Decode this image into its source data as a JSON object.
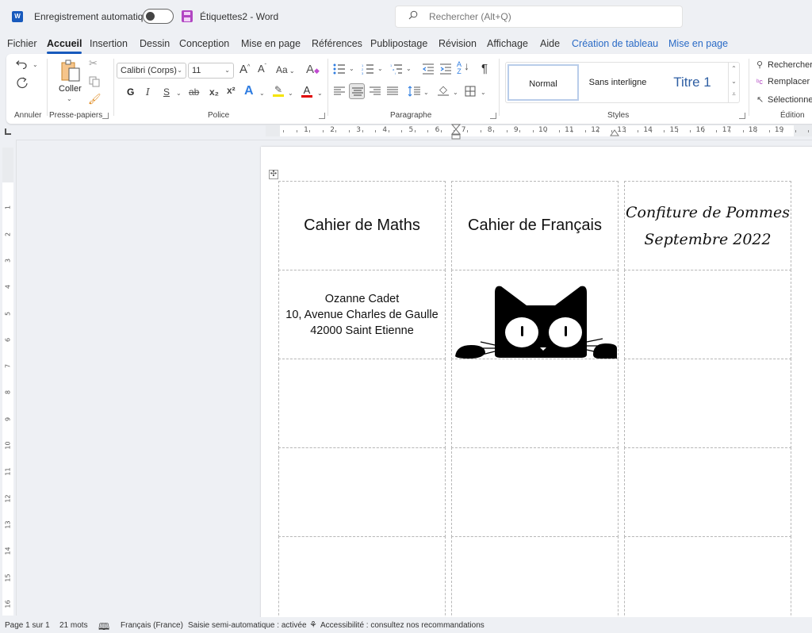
{
  "titlebar": {
    "app_icon": "word-icon",
    "autosave_label": "Enregistrement automatique",
    "autosave_on": false,
    "save_icon": "save-icon",
    "doc_title": "Étiquettes2  -  Word"
  },
  "search": {
    "placeholder": "Rechercher (Alt+Q)",
    "icon": "search-icon"
  },
  "tabs": [
    {
      "label": "Fichier"
    },
    {
      "label": "Accueil",
      "active": true
    },
    {
      "label": "Insertion"
    },
    {
      "label": "Dessin"
    },
    {
      "label": "Conception"
    },
    {
      "label": "Mise en page"
    },
    {
      "label": "Références"
    },
    {
      "label": "Publipostage"
    },
    {
      "label": "Révision"
    },
    {
      "label": "Affichage"
    },
    {
      "label": "Aide"
    },
    {
      "label": "Création de tableau",
      "contextual": true
    },
    {
      "label": "Mise en page",
      "contextual": true
    }
  ],
  "ribbon": {
    "undo": {
      "group_label": "Annuler",
      "undo_icon": "undo-icon",
      "redo_icon": "redo-icon"
    },
    "clipboard": {
      "group_label": "Presse-papiers",
      "paste_label": "Coller",
      "cut_icon": "scissors-icon",
      "copy_icon": "copy-icon",
      "format_painter_icon": "brush-icon"
    },
    "font": {
      "group_label": "Police",
      "font_name": "Calibri (Corps)",
      "font_size": "11",
      "grow_label": "A",
      "shrink_label": "A",
      "case_label": "Aa",
      "bold_label": "G",
      "italic_label": "I",
      "underline_label": "S",
      "strike_label": "ab",
      "subscript_label": "x₂",
      "superscript_label": "x²",
      "highlight_color": "#f5e400",
      "font_color": "#e00000"
    },
    "paragraph": {
      "group_label": "Paragraphe",
      "pilcrow": "¶",
      "sort_label": "A Z"
    },
    "styles": {
      "group_label": "Styles",
      "items": [
        {
          "label": "Normal",
          "selected": true
        },
        {
          "label": "Sans interligne"
        },
        {
          "label": "Titre 1"
        }
      ]
    },
    "editing": {
      "group_label": "Édition",
      "items": [
        {
          "label": "Rechercher",
          "icon": "search-icon"
        },
        {
          "label": "Remplacer",
          "icon": "replace-icon"
        },
        {
          "label": "Sélectionner",
          "icon": "select-cursor-icon"
        }
      ]
    }
  },
  "ruler": {
    "horizontal": [
      "1",
      "2",
      "3",
      "4",
      "5",
      "6",
      "7",
      "8",
      "9",
      "10",
      "11",
      "12",
      "13",
      "14",
      "15",
      "16",
      "17",
      "18",
      "19"
    ],
    "vertical": [
      "1",
      "2",
      "3",
      "4",
      "5",
      "6",
      "7",
      "8",
      "9",
      "10",
      "11",
      "12",
      "13",
      "14",
      "15",
      "16"
    ]
  },
  "document": {
    "labels": [
      [
        "Cahier de Maths",
        "Cahier de Français",
        "Confiture de Pommes\nSeptembre 2022"
      ],
      [
        "Ozanne Cadet\n10, Avenue Charles de Gaulle\n42000 Saint Etienne",
        "[cat-image]",
        ""
      ],
      [
        "",
        "",
        ""
      ],
      [
        "",
        "",
        ""
      ],
      [
        "",
        "",
        ""
      ]
    ],
    "label_maths": "Cahier de Maths",
    "label_francais": "Cahier de Français",
    "label_jam_line1": "Confiture de Pommes",
    "label_jam_line2": "Septembre 2022",
    "address_line1": "Ozanne Cadet",
    "address_line2": "10, Avenue Charles de Gaulle",
    "address_line3": "42000 Saint Etienne",
    "image": "black-cat-peeking-icon"
  },
  "statusbar": {
    "page": "Page 1 sur 1",
    "words": "21 mots",
    "proofing_icon": "book-check-icon",
    "language": "Français (France)",
    "autocomplete": "Saisie semi-automatique : activée",
    "accessibility": "Accessibilité : consultez nos recommandations"
  }
}
